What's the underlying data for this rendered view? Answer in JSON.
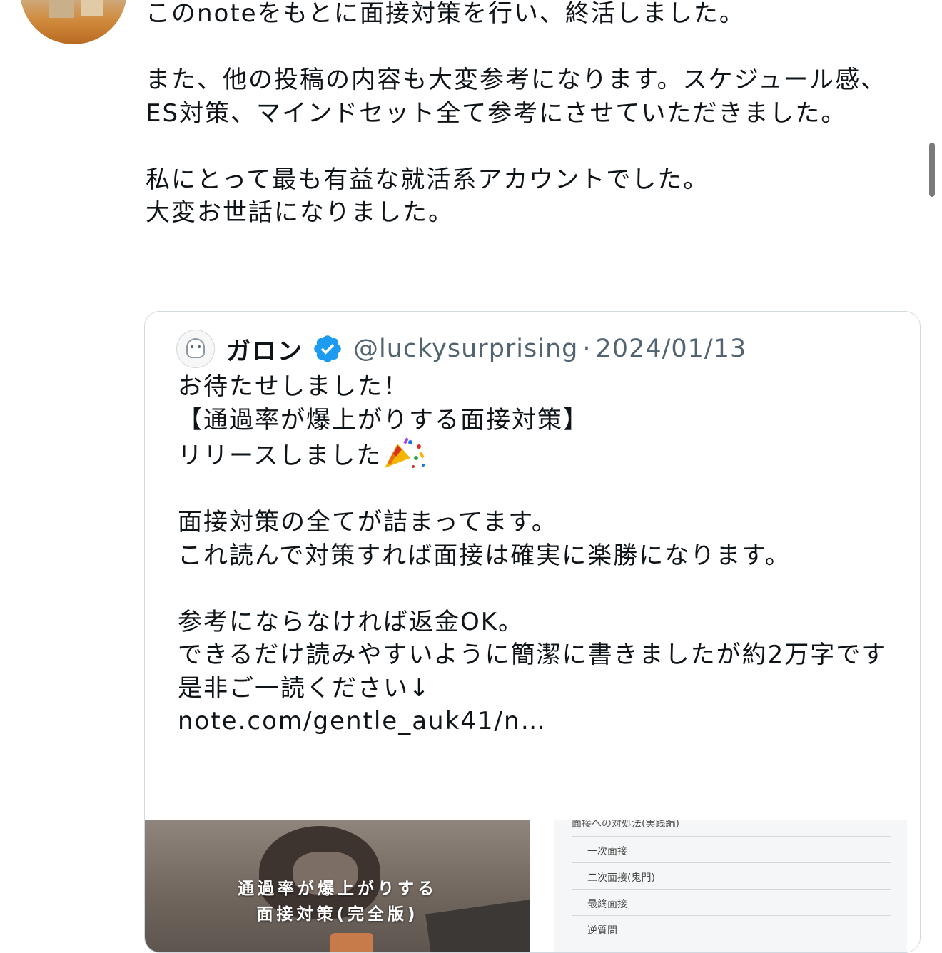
{
  "post": {
    "text": "このnoteをもとに面接対策を行い、終活しました。\n\nまた、他の投稿の内容も大変参考になります。スケジュール感、ES対策、マインドセット全て参考にさせていただきました。\n\n私にとって最も有益な就活系アカウントでした。\n大変お世話になりました。"
  },
  "quote": {
    "display_name": "ガロン",
    "verified": true,
    "handle": "@luckysurprising",
    "separator": "·",
    "date": "2024/01/13",
    "text_before_emoji": "お待たせしました！\n【通過率が爆上がりする面接対策】\nリリースしました",
    "emoji_icon": "party-popper-icon",
    "text_after_emoji": "\n\n面接対策の全てが詰まってます。\nこれ読んで対策すれば面接は確実に楽勝になります。\n\n参考にならなければ返金OK。\nできるだけ読みやすいように簡潔に書きましたが約2万字です\n是非ご一読ください↓\nnote.com/gentle_auk41/n…",
    "media": {
      "cover_title_line1": "通過率が爆上がりする",
      "cover_title_line2": "面接対策(完全版)",
      "toc_heading": "面接への対処法(実践編)",
      "toc_items": [
        "一次面接",
        "二次面接(鬼門)",
        "最終面接",
        "逆質問"
      ]
    }
  },
  "colors": {
    "text": "#0f1419",
    "secondary": "#536471",
    "verified": "#1d9bf0",
    "border": "#cfd9de"
  }
}
